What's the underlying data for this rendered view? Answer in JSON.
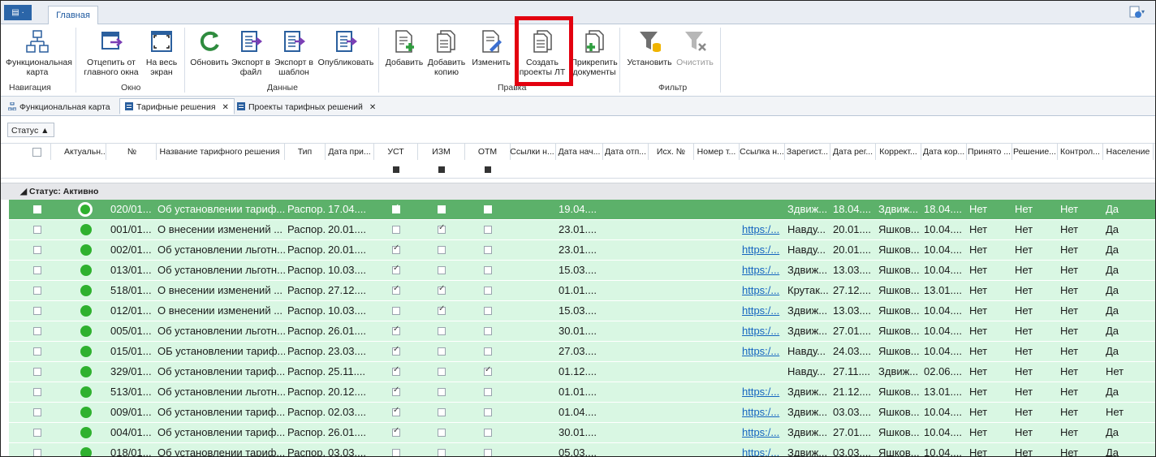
{
  "ribbon_tabs": {
    "app_button": "▤ ·",
    "home": "Главная"
  },
  "ribbon": {
    "functional_map": "Функциональная карта",
    "detach_window": "Отцепить от главного окна",
    "fullscreen": "На весь экран",
    "refresh": "Обновить",
    "export_file": "Экспорт в файл",
    "export_template": "Экспорт в шаблон",
    "publish": "Опубликовать",
    "add": "Добавить",
    "add_copy": "Добавить копию",
    "edit": "Изменить",
    "create_lt": "Создать проекты ЛТ",
    "attach_docs": "Прикрепить документы",
    "set_filter": "Установить",
    "clear_filter": "Очистить"
  },
  "groups": {
    "navigation": "Навигация",
    "window": "Окно",
    "data": "Данные",
    "edit": "Правка",
    "filter": "Фильтр"
  },
  "doc_tabs": [
    {
      "label": "Функциональная карта"
    },
    {
      "label": "Тарифные решения"
    },
    {
      "label": "Проекты тарифных решений"
    }
  ],
  "group_panel": {
    "status_button": "Статус ▲"
  },
  "columns": [
    "Актуальн...",
    "№",
    "Название тарифного решения",
    "Тип",
    "Дата при...",
    "УСТ",
    "ИЗМ",
    "ОТМ",
    "Ссылки н...",
    "Дата нач...",
    "Дата отп...",
    "Исх. №",
    "Номер т...",
    "Ссылка н...",
    "Зарегист...",
    "Дата рег...",
    "Коррект...",
    "Дата кор...",
    "Принято ...",
    "Решение...",
    "Контрол...",
    "Население"
  ],
  "group_header": "◢  Статус: Активно",
  "rows": [
    {
      "num": "020/01...",
      "name": "Об установлении тариф...",
      "type": "Распор...",
      "date": "17.04....",
      "ust": true,
      "izm": false,
      "otm": false,
      "start": "19.04....",
      "link": "",
      "reg": "Здвиж...",
      "regdate": "18.04....",
      "corr": "Здвиж...",
      "corrdate": "18.04....",
      "accepted": "Нет",
      "decision": "Нет",
      "control": "Нет",
      "population": "Да"
    },
    {
      "num": "001/01...",
      "name": "О внесении изменений ...",
      "type": "Распор...",
      "date": "20.01....",
      "ust": false,
      "izm": true,
      "otm": false,
      "start": "23.01....",
      "link": "https:/...",
      "reg": "Навду...",
      "regdate": "20.01....",
      "corr": "Яшков...",
      "corrdate": "10.04....",
      "accepted": "Нет",
      "decision": "Нет",
      "control": "Нет",
      "population": "Да"
    },
    {
      "num": "002/01...",
      "name": "Об установлении льготн...",
      "type": "Распор...",
      "date": "20.01....",
      "ust": true,
      "izm": false,
      "otm": false,
      "start": "23.01....",
      "link": "https:/...",
      "reg": "Навду...",
      "regdate": "20.01....",
      "corr": "Яшков...",
      "corrdate": "10.04....",
      "accepted": "Нет",
      "decision": "Нет",
      "control": "Нет",
      "population": "Да"
    },
    {
      "num": "013/01...",
      "name": "Об установлении льготн...",
      "type": "Распор...",
      "date": "10.03....",
      "ust": true,
      "izm": false,
      "otm": false,
      "start": "15.03....",
      "link": "https:/...",
      "reg": "Здвиж...",
      "regdate": "13.03....",
      "corr": "Яшков...",
      "corrdate": "10.04....",
      "accepted": "Нет",
      "decision": "Нет",
      "control": "Нет",
      "population": "Да"
    },
    {
      "num": "518/01...",
      "name": "О внесении изменений ...",
      "type": "Распор...",
      "date": "27.12....",
      "ust": true,
      "izm": true,
      "otm": false,
      "start": "01.01....",
      "link": "https:/...",
      "reg": "Крутак...",
      "regdate": "27.12....",
      "corr": "Яшков...",
      "corrdate": "13.01....",
      "accepted": "Нет",
      "decision": "Нет",
      "control": "Нет",
      "population": "Да"
    },
    {
      "num": "012/01...",
      "name": "О внесении изменений ...",
      "type": "Распор...",
      "date": "10.03....",
      "ust": false,
      "izm": true,
      "otm": false,
      "start": "15.03....",
      "link": "https:/...",
      "reg": "Здвиж...",
      "regdate": "13.03....",
      "corr": "Яшков...",
      "corrdate": "10.04....",
      "accepted": "Нет",
      "decision": "Нет",
      "control": "Нет",
      "population": "Да"
    },
    {
      "num": "005/01...",
      "name": "Об установлении льготн...",
      "type": "Распор...",
      "date": "26.01....",
      "ust": true,
      "izm": false,
      "otm": false,
      "start": "30.01....",
      "link": "https:/...",
      "reg": "Здвиж...",
      "regdate": "27.01....",
      "corr": "Яшков...",
      "corrdate": "10.04....",
      "accepted": "Нет",
      "decision": "Нет",
      "control": "Нет",
      "population": "Да"
    },
    {
      "num": "015/01...",
      "name": "ОБ установлении тариф...",
      "type": "Распор...",
      "date": "23.03....",
      "ust": true,
      "izm": false,
      "otm": false,
      "start": "27.03....",
      "link": "https:/...",
      "reg": "Навду...",
      "regdate": "24.03....",
      "corr": "Яшков...",
      "corrdate": "10.04....",
      "accepted": "Нет",
      "decision": "Нет",
      "control": "Нет",
      "population": "Да"
    },
    {
      "num": "329/01...",
      "name": "Об установлении тариф...",
      "type": "Распор...",
      "date": "25.11....",
      "ust": true,
      "izm": false,
      "otm": true,
      "start": "01.12....",
      "link": "",
      "reg": "Навду...",
      "regdate": "27.11....",
      "corr": "Здвиж...",
      "corrdate": "02.06....",
      "accepted": "Нет",
      "decision": "Нет",
      "control": "Нет",
      "population": "Нет"
    },
    {
      "num": "513/01...",
      "name": "Об установлении льготн...",
      "type": "Распор...",
      "date": "20.12....",
      "ust": true,
      "izm": false,
      "otm": false,
      "start": "01.01....",
      "link": "https:/...",
      "reg": "Здвиж...",
      "regdate": "21.12....",
      "corr": "Яшков...",
      "corrdate": "13.01....",
      "accepted": "Нет",
      "decision": "Нет",
      "control": "Нет",
      "population": "Да"
    },
    {
      "num": "009/01...",
      "name": "Об установлении тариф...",
      "type": "Распор...",
      "date": "02.03....",
      "ust": true,
      "izm": false,
      "otm": false,
      "start": "01.04....",
      "link": "https:/...",
      "reg": "Здвиж...",
      "regdate": "03.03....",
      "corr": "Яшков...",
      "corrdate": "10.04....",
      "accepted": "Нет",
      "decision": "Нет",
      "control": "Нет",
      "population": "Нет"
    },
    {
      "num": "004/01...",
      "name": "Об установлении тариф...",
      "type": "Распор...",
      "date": "26.01....",
      "ust": true,
      "izm": false,
      "otm": false,
      "start": "30.01....",
      "link": "https:/...",
      "reg": "Здвиж...",
      "regdate": "27.01....",
      "corr": "Яшков...",
      "corrdate": "10.04....",
      "accepted": "Нет",
      "decision": "Нет",
      "control": "Нет",
      "population": "Да"
    },
    {
      "num": "018/01...",
      "name": "Об установлении тариф...",
      "type": "Распор...",
      "date": "03.03....",
      "ust": false,
      "izm": false,
      "otm": false,
      "start": "05.03....",
      "link": "https:/...",
      "reg": "Здвиж...",
      "regdate": "03.03....",
      "corr": "Яшков...",
      "corrdate": "10.04....",
      "accepted": "Нет",
      "decision": "Нет",
      "control": "Нет",
      "population": "Да"
    }
  ]
}
